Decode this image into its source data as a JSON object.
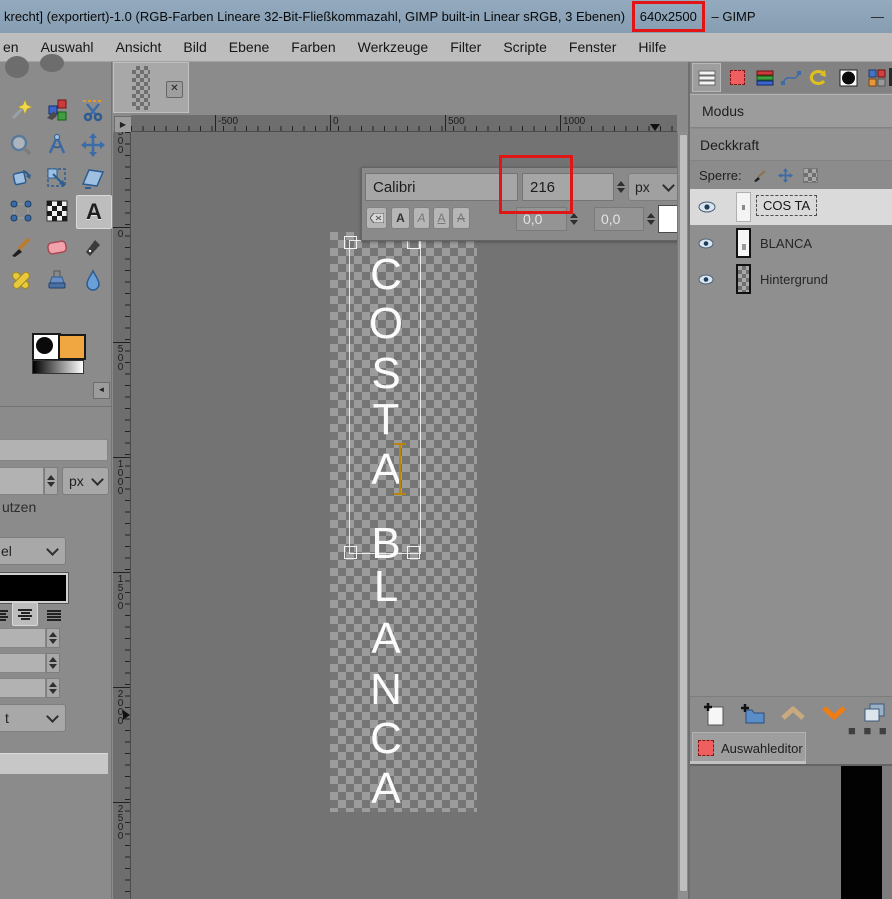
{
  "window": {
    "title_prefix": "krecht] (exportiert)-1.0 (RGB-Farben Lineare 32-Bit-Fließkommazahl, GIMP built-in Linear sRGB, 3 Ebenen)",
    "size_badge": "640x2500",
    "title_suffix": "– GIMP",
    "minimize_glyph": "—"
  },
  "menubar": {
    "items": [
      "en",
      "Auswahl",
      "Ansicht",
      "Bild",
      "Ebene",
      "Farben",
      "Werkzeuge",
      "Filter",
      "Scripte",
      "Fenster",
      "Hilfe"
    ]
  },
  "tool_options": {
    "unit_label": "px",
    "partial_label": "utzen",
    "hinting_fragment": "el",
    "box_fragment": "t"
  },
  "canvas": {
    "h_ruler_labels": [
      "-500",
      "0",
      "500",
      "1000"
    ],
    "v_ruler_labels": [
      "-500",
      "0",
      "500",
      "1000",
      "1500",
      "2000",
      "2500"
    ],
    "letters": [
      "C",
      "O",
      "S",
      "T",
      "A",
      "B",
      "L",
      "A",
      "N",
      "C",
      "A"
    ]
  },
  "text_toolbar": {
    "font_name": "Calibri",
    "font_size": "216",
    "unit": "px",
    "baseline_offset": "0,0",
    "kerning": "0,0"
  },
  "layers_panel": {
    "mode_label": "Modus",
    "opacity_label": "Deckkraft",
    "lock_label": "Sperre:",
    "layers": [
      {
        "name": "COS TA"
      },
      {
        "name": "BLANCA"
      },
      {
        "name": "Hintergrund"
      }
    ]
  },
  "selection_editor": {
    "tab_label": "Auswahleditor"
  },
  "colors": {
    "annotation_red": "#e01616",
    "background_swatch": "#f0a741",
    "cursor_orange": "#b8860b"
  }
}
